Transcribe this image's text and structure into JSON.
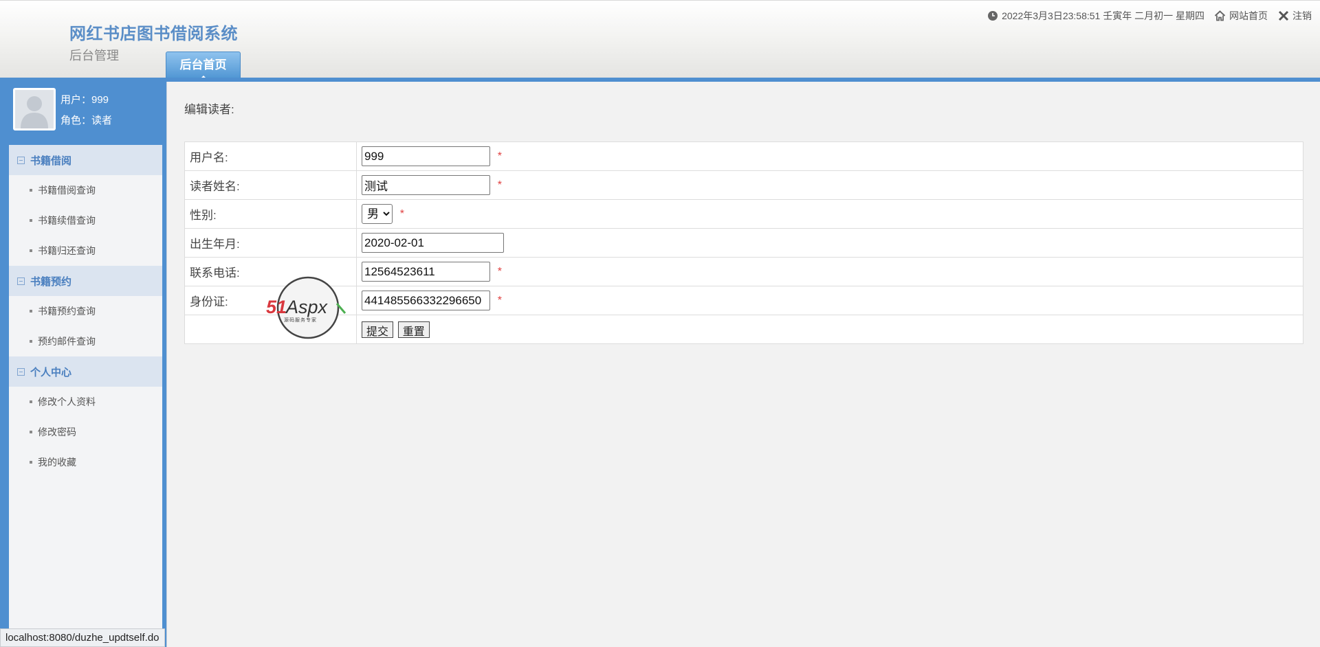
{
  "header": {
    "title": "网红书店图书借阅系统",
    "subtitle": "后台管理",
    "nav_tab": "后台首页",
    "datetime": "2022年3月3日23:58:51 壬寅年 二月初一 星期四",
    "home_link": "网站首页",
    "logout_link": "注销"
  },
  "user": {
    "name_line": "用户：999",
    "role_line": "角色：读者"
  },
  "menu": {
    "groups": [
      {
        "title": "书籍借阅",
        "items": [
          "书籍借阅查询",
          "书籍续借查询",
          "书籍归还查询"
        ]
      },
      {
        "title": "书籍预约",
        "items": [
          "书籍预约查询",
          "预约邮件查询"
        ]
      },
      {
        "title": "个人中心",
        "items": [
          "修改个人资料",
          "修改密码",
          "我的收藏"
        ]
      }
    ]
  },
  "form": {
    "heading": "编辑读者:",
    "required_mark": "*",
    "fields": {
      "username": {
        "label": "用户名:",
        "value": "999"
      },
      "reader_name": {
        "label": "读者姓名:",
        "value": "测试"
      },
      "gender": {
        "label": "性别:",
        "value": "男"
      },
      "birth": {
        "label": "出生年月:",
        "value": "2020-02-01"
      },
      "phone": {
        "label": "联系电话:",
        "value": "12564523611"
      },
      "id_card": {
        "label": "身份证:",
        "value": "441485566332296650"
      }
    },
    "submit_label": "提交",
    "reset_label": "重置"
  },
  "watermark": {
    "brand_number": "51",
    "brand_word": "Aspx",
    "tagline": "源码服务专家"
  },
  "status_bar": {
    "url": "localhost:8080/duzhe_updtself.do"
  }
}
